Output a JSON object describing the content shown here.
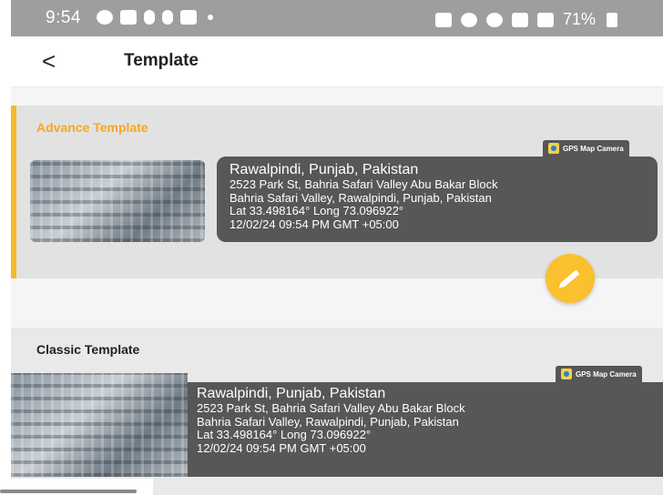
{
  "status_bar": {
    "time": "9:54",
    "battery": "71%",
    "left_icons": [
      "messenger-icon",
      "youtube-icon",
      "tiktok-icon",
      "tiktok-icon",
      "shopping-bag-icon",
      "dot-icon"
    ],
    "right_icons": [
      "nfc-icon",
      "alarm-icon",
      "location-icon",
      "wifi-icon",
      "signal-icon"
    ]
  },
  "app_bar": {
    "back": "<",
    "title": "Template"
  },
  "advance": {
    "title": "Advance Template",
    "badge": "GPS Map Camera",
    "location": "Rawalpindi, Punjab, Pakistan",
    "lines": [
      "2523 Park St, Bahria Safari Valley Abu Bakar Block",
      "Bahria Safari Valley, Rawalpindi, Punjab, Pakistan",
      "Lat 33.498164° Long 73.096922°",
      "12/02/24 09:54 PM GMT +05:00"
    ],
    "accent_color": "#f9b82a"
  },
  "classic": {
    "title": "Classic Template",
    "badge": "GPS Map Camera",
    "location": "Rawalpindi, Punjab, Pakistan",
    "lines": [
      "2523 Park St, Bahria Safari Valley Abu Bakar Block",
      "Bahria Safari Valley, Rawalpindi, Punjab, Pakistan",
      "Lat 33.498164° Long 73.096922°",
      "12/02/24 09:54 PM GMT +05:00"
    ]
  },
  "edit_button_color": "#fbc02d"
}
